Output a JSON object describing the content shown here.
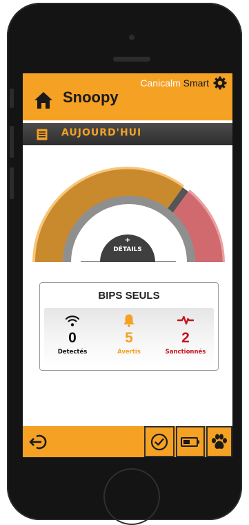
{
  "header": {
    "pet_name": "Snoopy",
    "brand_name": "Canicalm",
    "brand_suffix": " Smart"
  },
  "day_bar": {
    "label": "AUJOURD'HUI"
  },
  "gauge": {
    "plus": "+",
    "details_label": "DÉTAILS",
    "colors": {
      "main": "#c88a2c",
      "main_edge": "#f7c67a",
      "alert": "#d06a6e",
      "base": "#8f8f8f"
    }
  },
  "card": {
    "title": "BIPS SEULS",
    "stats": [
      {
        "icon": "wifi-icon",
        "value": "0",
        "label": "Detectés",
        "color": "#111111"
      },
      {
        "icon": "bell-icon",
        "value": "5",
        "label": "Avertis",
        "color": "#f4a124"
      },
      {
        "icon": "pulse-icon",
        "value": "2",
        "label": "Sanctionnés",
        "color": "#c4161c"
      }
    ]
  },
  "colors": {
    "accent": "#f4a124",
    "dark": "#2f2f2f"
  },
  "footer": {
    "icons": [
      "logout-icon",
      "check-circle-icon",
      "battery-icon",
      "paw-icon"
    ]
  }
}
